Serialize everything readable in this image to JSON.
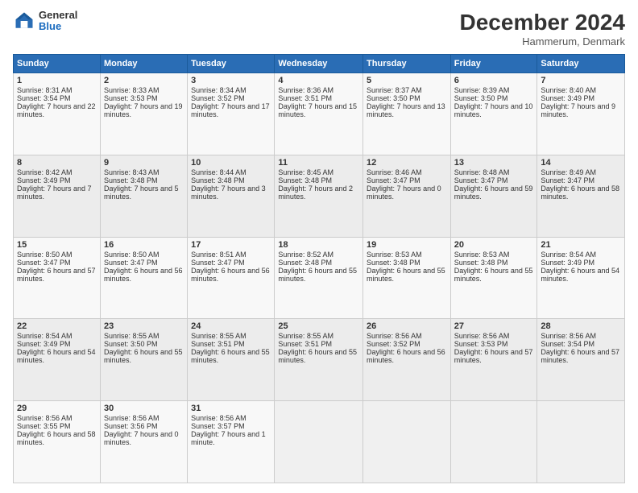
{
  "header": {
    "logo_line1": "General",
    "logo_line2": "Blue",
    "month_title": "December 2024",
    "location": "Hammerum, Denmark"
  },
  "days_of_week": [
    "Sunday",
    "Monday",
    "Tuesday",
    "Wednesday",
    "Thursday",
    "Friday",
    "Saturday"
  ],
  "weeks": [
    [
      {
        "day": 1,
        "rise": "8:31 AM",
        "set": "3:54 PM",
        "daylight": "7 hours and 22 minutes."
      },
      {
        "day": 2,
        "rise": "8:33 AM",
        "set": "3:53 PM",
        "daylight": "7 hours and 19 minutes."
      },
      {
        "day": 3,
        "rise": "8:34 AM",
        "set": "3:52 PM",
        "daylight": "7 hours and 17 minutes."
      },
      {
        "day": 4,
        "rise": "8:36 AM",
        "set": "3:51 PM",
        "daylight": "7 hours and 15 minutes."
      },
      {
        "day": 5,
        "rise": "8:37 AM",
        "set": "3:50 PM",
        "daylight": "7 hours and 13 minutes."
      },
      {
        "day": 6,
        "rise": "8:39 AM",
        "set": "3:50 PM",
        "daylight": "7 hours and 10 minutes."
      },
      {
        "day": 7,
        "rise": "8:40 AM",
        "set": "3:49 PM",
        "daylight": "7 hours and 9 minutes."
      }
    ],
    [
      {
        "day": 8,
        "rise": "8:42 AM",
        "set": "3:49 PM",
        "daylight": "7 hours and 7 minutes."
      },
      {
        "day": 9,
        "rise": "8:43 AM",
        "set": "3:48 PM",
        "daylight": "7 hours and 5 minutes."
      },
      {
        "day": 10,
        "rise": "8:44 AM",
        "set": "3:48 PM",
        "daylight": "7 hours and 3 minutes."
      },
      {
        "day": 11,
        "rise": "8:45 AM",
        "set": "3:48 PM",
        "daylight": "7 hours and 2 minutes."
      },
      {
        "day": 12,
        "rise": "8:46 AM",
        "set": "3:47 PM",
        "daylight": "7 hours and 0 minutes."
      },
      {
        "day": 13,
        "rise": "8:48 AM",
        "set": "3:47 PM",
        "daylight": "6 hours and 59 minutes."
      },
      {
        "day": 14,
        "rise": "8:49 AM",
        "set": "3:47 PM",
        "daylight": "6 hours and 58 minutes."
      }
    ],
    [
      {
        "day": 15,
        "rise": "8:50 AM",
        "set": "3:47 PM",
        "daylight": "6 hours and 57 minutes."
      },
      {
        "day": 16,
        "rise": "8:50 AM",
        "set": "3:47 PM",
        "daylight": "6 hours and 56 minutes."
      },
      {
        "day": 17,
        "rise": "8:51 AM",
        "set": "3:47 PM",
        "daylight": "6 hours and 56 minutes."
      },
      {
        "day": 18,
        "rise": "8:52 AM",
        "set": "3:48 PM",
        "daylight": "6 hours and 55 minutes."
      },
      {
        "day": 19,
        "rise": "8:53 AM",
        "set": "3:48 PM",
        "daylight": "6 hours and 55 minutes."
      },
      {
        "day": 20,
        "rise": "8:53 AM",
        "set": "3:48 PM",
        "daylight": "6 hours and 55 minutes."
      },
      {
        "day": 21,
        "rise": "8:54 AM",
        "set": "3:49 PM",
        "daylight": "6 hours and 54 minutes."
      }
    ],
    [
      {
        "day": 22,
        "rise": "8:54 AM",
        "set": "3:49 PM",
        "daylight": "6 hours and 54 minutes."
      },
      {
        "day": 23,
        "rise": "8:55 AM",
        "set": "3:50 PM",
        "daylight": "6 hours and 55 minutes."
      },
      {
        "day": 24,
        "rise": "8:55 AM",
        "set": "3:51 PM",
        "daylight": "6 hours and 55 minutes."
      },
      {
        "day": 25,
        "rise": "8:55 AM",
        "set": "3:51 PM",
        "daylight": "6 hours and 55 minutes."
      },
      {
        "day": 26,
        "rise": "8:56 AM",
        "set": "3:52 PM",
        "daylight": "6 hours and 56 minutes."
      },
      {
        "day": 27,
        "rise": "8:56 AM",
        "set": "3:53 PM",
        "daylight": "6 hours and 57 minutes."
      },
      {
        "day": 28,
        "rise": "8:56 AM",
        "set": "3:54 PM",
        "daylight": "6 hours and 57 minutes."
      }
    ],
    [
      {
        "day": 29,
        "rise": "8:56 AM",
        "set": "3:55 PM",
        "daylight": "6 hours and 58 minutes."
      },
      {
        "day": 30,
        "rise": "8:56 AM",
        "set": "3:56 PM",
        "daylight": "7 hours and 0 minutes."
      },
      {
        "day": 31,
        "rise": "8:56 AM",
        "set": "3:57 PM",
        "daylight": "7 hours and 1 minute."
      },
      null,
      null,
      null,
      null
    ]
  ]
}
